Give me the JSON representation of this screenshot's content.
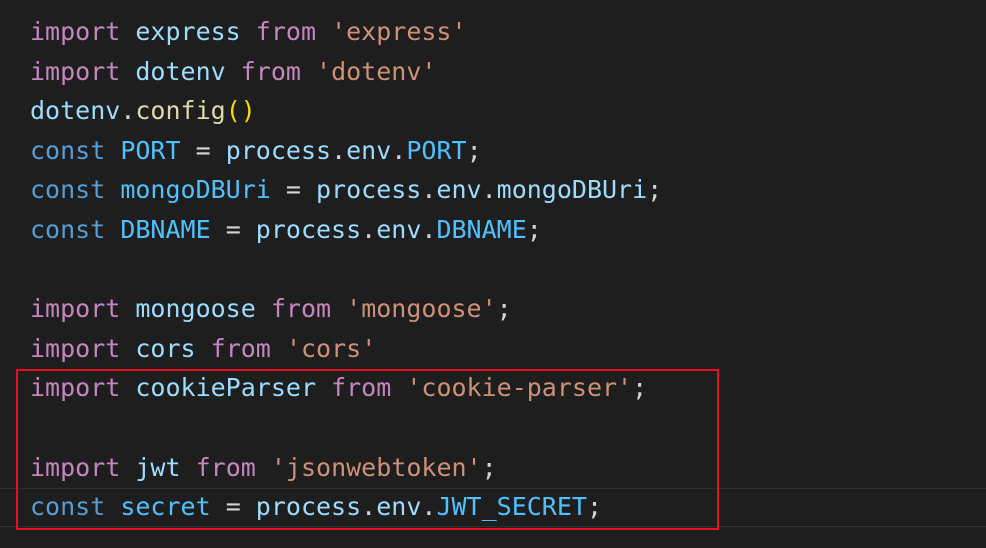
{
  "editor": {
    "lines": [
      {
        "tokens": [
          {
            "text": "import",
            "type": "kw-import"
          },
          {
            "text": " ",
            "type": "punc"
          },
          {
            "text": "express",
            "type": "ident"
          },
          {
            "text": " ",
            "type": "punc"
          },
          {
            "text": "from",
            "type": "kw-import"
          },
          {
            "text": " ",
            "type": "punc"
          },
          {
            "text": "'express'",
            "type": "str"
          }
        ]
      },
      {
        "tokens": [
          {
            "text": "import",
            "type": "kw-import"
          },
          {
            "text": " ",
            "type": "punc"
          },
          {
            "text": "dotenv",
            "type": "ident"
          },
          {
            "text": " ",
            "type": "punc"
          },
          {
            "text": "from",
            "type": "kw-import"
          },
          {
            "text": " ",
            "type": "punc"
          },
          {
            "text": "'dotenv'",
            "type": "str"
          }
        ]
      },
      {
        "tokens": [
          {
            "text": "dotenv",
            "type": "ident"
          },
          {
            "text": ".",
            "type": "punc"
          },
          {
            "text": "config",
            "type": "fn"
          },
          {
            "text": "()",
            "type": "paren"
          }
        ]
      },
      {
        "tokens": [
          {
            "text": "const",
            "type": "kw-const"
          },
          {
            "text": " ",
            "type": "punc"
          },
          {
            "text": "PORT",
            "type": "constant"
          },
          {
            "text": " = ",
            "type": "punc"
          },
          {
            "text": "process",
            "type": "ident"
          },
          {
            "text": ".",
            "type": "punc"
          },
          {
            "text": "env",
            "type": "ident"
          },
          {
            "text": ".",
            "type": "punc"
          },
          {
            "text": "PORT",
            "type": "constant"
          },
          {
            "text": ";",
            "type": "punc"
          }
        ]
      },
      {
        "tokens": [
          {
            "text": "const",
            "type": "kw-const"
          },
          {
            "text": " ",
            "type": "punc"
          },
          {
            "text": "mongoDBUri",
            "type": "constant"
          },
          {
            "text": " = ",
            "type": "punc"
          },
          {
            "text": "process",
            "type": "ident"
          },
          {
            "text": ".",
            "type": "punc"
          },
          {
            "text": "env",
            "type": "ident"
          },
          {
            "text": ".",
            "type": "punc"
          },
          {
            "text": "mongoDBUri",
            "type": "ident"
          },
          {
            "text": ";",
            "type": "punc"
          }
        ]
      },
      {
        "tokens": [
          {
            "text": "const",
            "type": "kw-const"
          },
          {
            "text": " ",
            "type": "punc"
          },
          {
            "text": "DBNAME",
            "type": "constant"
          },
          {
            "text": " = ",
            "type": "punc"
          },
          {
            "text": "process",
            "type": "ident"
          },
          {
            "text": ".",
            "type": "punc"
          },
          {
            "text": "env",
            "type": "ident"
          },
          {
            "text": ".",
            "type": "punc"
          },
          {
            "text": "DBNAME",
            "type": "constant"
          },
          {
            "text": ";",
            "type": "punc"
          }
        ]
      },
      {
        "tokens": []
      },
      {
        "tokens": [
          {
            "text": "import",
            "type": "kw-import"
          },
          {
            "text": " ",
            "type": "punc"
          },
          {
            "text": "mongoose",
            "type": "ident"
          },
          {
            "text": " ",
            "type": "punc"
          },
          {
            "text": "from",
            "type": "kw-import"
          },
          {
            "text": " ",
            "type": "punc"
          },
          {
            "text": "'mongoose'",
            "type": "str"
          },
          {
            "text": ";",
            "type": "punc"
          }
        ]
      },
      {
        "tokens": [
          {
            "text": "import",
            "type": "kw-import"
          },
          {
            "text": " ",
            "type": "punc"
          },
          {
            "text": "cors",
            "type": "ident"
          },
          {
            "text": " ",
            "type": "punc"
          },
          {
            "text": "from",
            "type": "kw-import"
          },
          {
            "text": " ",
            "type": "punc"
          },
          {
            "text": "'cors'",
            "type": "str"
          }
        ]
      },
      {
        "tokens": [
          {
            "text": "import",
            "type": "kw-import"
          },
          {
            "text": " ",
            "type": "punc"
          },
          {
            "text": "cookieParser",
            "type": "ident"
          },
          {
            "text": " ",
            "type": "punc"
          },
          {
            "text": "from",
            "type": "kw-import"
          },
          {
            "text": " ",
            "type": "punc"
          },
          {
            "text": "'cookie-parser'",
            "type": "str"
          },
          {
            "text": ";",
            "type": "punc"
          }
        ]
      },
      {
        "tokens": []
      },
      {
        "tokens": [
          {
            "text": "import",
            "type": "kw-import"
          },
          {
            "text": " ",
            "type": "punc"
          },
          {
            "text": "jwt",
            "type": "ident"
          },
          {
            "text": " ",
            "type": "punc"
          },
          {
            "text": "from",
            "type": "kw-import"
          },
          {
            "text": " ",
            "type": "punc"
          },
          {
            "text": "'jsonwebtoken'",
            "type": "str"
          },
          {
            "text": ";",
            "type": "punc"
          }
        ]
      },
      {
        "tokens": [
          {
            "text": "const",
            "type": "kw-const"
          },
          {
            "text": " ",
            "type": "punc"
          },
          {
            "text": "secret",
            "type": "constant"
          },
          {
            "text": " = ",
            "type": "punc"
          },
          {
            "text": "process",
            "type": "ident"
          },
          {
            "text": ".",
            "type": "punc"
          },
          {
            "text": "env",
            "type": "ident"
          },
          {
            "text": ".",
            "type": "punc"
          },
          {
            "text": "JWT_SECRET",
            "type": "constant"
          },
          {
            "text": ";",
            "type": "punc"
          }
        ]
      }
    ]
  },
  "colors": {
    "background": "#1e1e1e",
    "import_keyword": "#c586c0",
    "const_keyword": "#569cd6",
    "identifier": "#9cdcfe",
    "function": "#dcdcaa",
    "string": "#ce9178",
    "constant": "#4fc1ff",
    "paren": "#ffd700",
    "highlight_box": "#e81123"
  }
}
